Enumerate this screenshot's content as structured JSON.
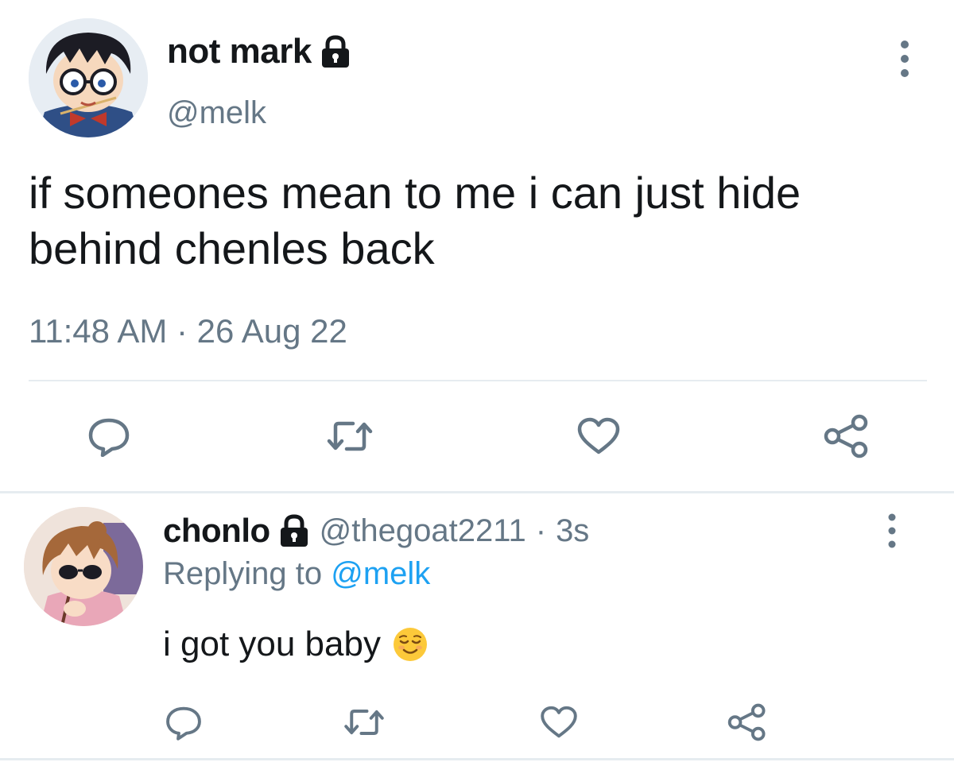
{
  "main_tweet": {
    "display_name": "not mark",
    "handle": "@melk",
    "avatar": "avatar-anime-boy-glasses",
    "protected_icon": "lock-icon",
    "more_icon": "more-vertical-icon",
    "text": "if someones mean to me i can just hide behind chenles back",
    "timestamp": "11:48 AM · 26 Aug 22",
    "actions": [
      "reply-icon",
      "retweet-icon",
      "like-icon",
      "share-icon"
    ]
  },
  "reply_tweet": {
    "display_name": "chonlo",
    "handle": "@thegoat2211",
    "separator": "·",
    "age": "3s",
    "avatar": "avatar-anime-girl-sunglasses",
    "protected_icon": "lock-icon",
    "more_icon": "more-vertical-icon",
    "replying_prefix": "Replying to",
    "replying_mention": "@melk",
    "text": "i got you baby",
    "emoji": "relieved-face-emoji",
    "actions": [
      "reply-icon",
      "retweet-icon",
      "like-icon",
      "share-icon"
    ]
  },
  "colors": {
    "text_primary": "#14171a",
    "text_secondary": "#657786",
    "link": "#1da1f2",
    "icon": "#657786",
    "divider": "#e6ecf0"
  }
}
